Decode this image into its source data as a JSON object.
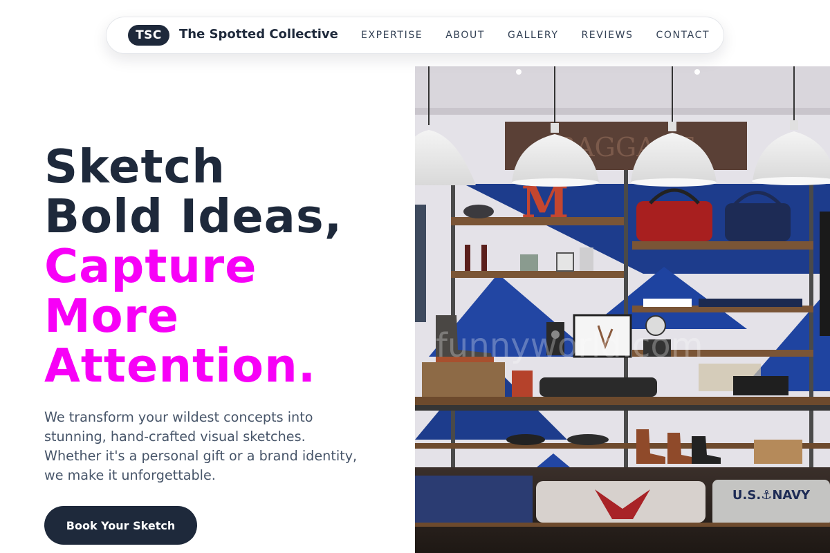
{
  "nav": {
    "logo_badge": "TSC",
    "brand_name": "The Spotted Collective",
    "links": [
      "EXPERTISE",
      "ABOUT",
      "GALLERY",
      "REVIEWS",
      "CONTACT"
    ]
  },
  "hero": {
    "title_lines": [
      "Sketch",
      "Bold Ideas,"
    ],
    "accent_lines": [
      "Capture",
      "More",
      "Attention."
    ],
    "description_lines": [
      "We transform your wildest concepts into",
      "stunning, hand-crafted visual sketches.",
      "Whether it's a personal gift or a brand identity,",
      "we make it unforgettable."
    ],
    "cta_label": "Book Your Sketch",
    "image": {
      "sign_text": "BAGGAGE",
      "sign_letter": "M",
      "watermark": "funnyworld.com",
      "shirt_text": "U.S.⚓NAVY"
    }
  },
  "colors": {
    "navy": "#1e293b",
    "accent_magenta": "#f700f7",
    "body_text": "#475569",
    "nav_text": "#334155"
  }
}
